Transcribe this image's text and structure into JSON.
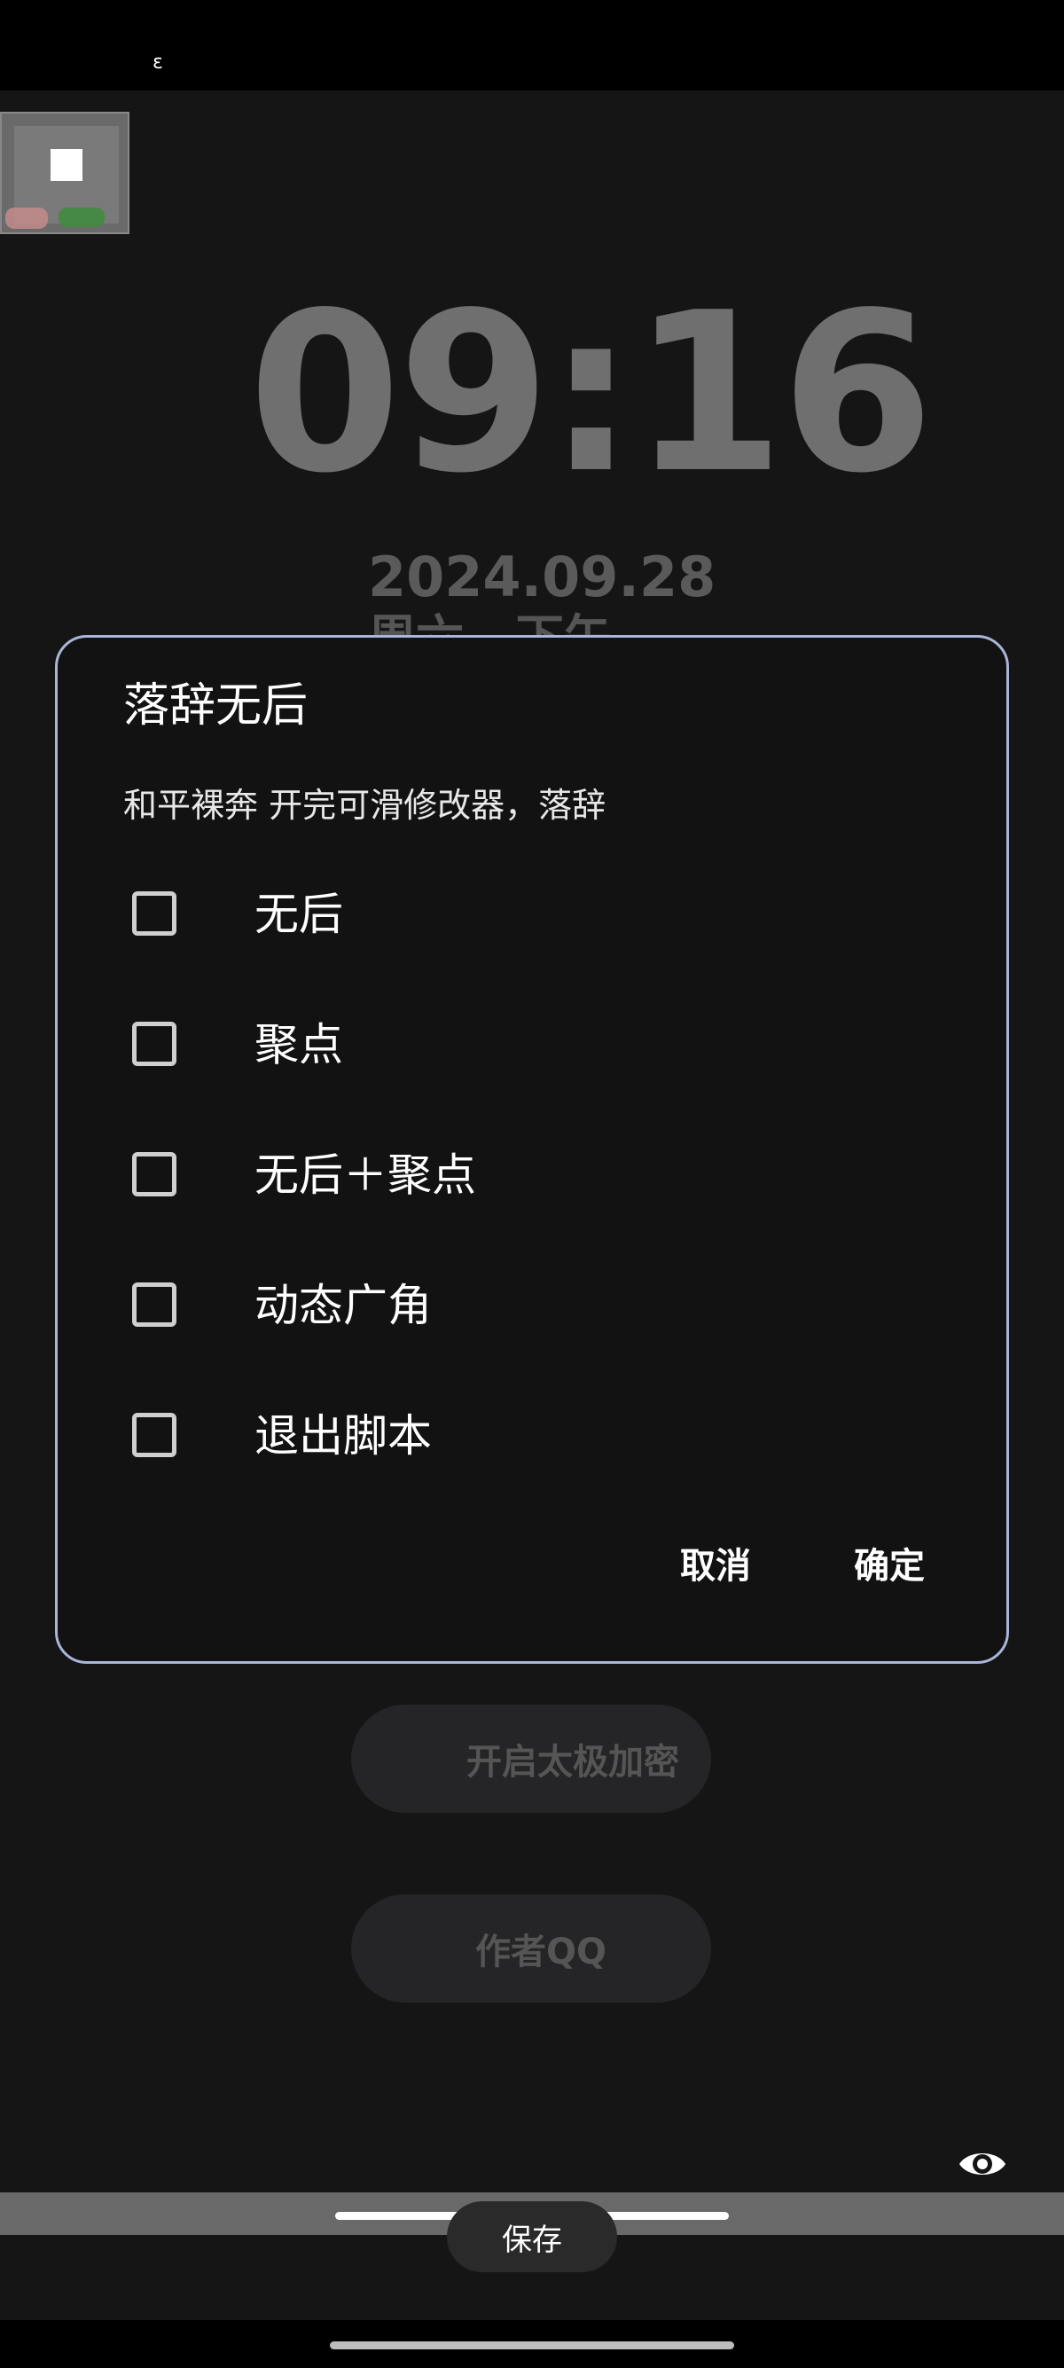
{
  "status_bar": {
    "icon": "signal-icon"
  },
  "lockscreen": {
    "time": "09:16",
    "date": "2024.09.28",
    "weekday": "周六 下午"
  },
  "dialog": {
    "title": "落辞无后",
    "message": "和平裸奔 开完可滑修改器，落辞",
    "options": [
      {
        "label": "无后",
        "checked": false
      },
      {
        "label": "聚点",
        "checked": false
      },
      {
        "label": "无后＋聚点",
        "checked": false
      },
      {
        "label": "动态广角",
        "checked": false
      },
      {
        "label": "退出脚本",
        "checked": false
      }
    ],
    "cancel_label": "取消",
    "confirm_label": "确定"
  },
  "buttons": {
    "encrypt_label": "开启太极加密",
    "author_label": "作者QQ",
    "save_label": "保存"
  },
  "colors": {
    "dialog_border": "#a9b6d8",
    "background": "#151515",
    "pill": "#252527"
  }
}
